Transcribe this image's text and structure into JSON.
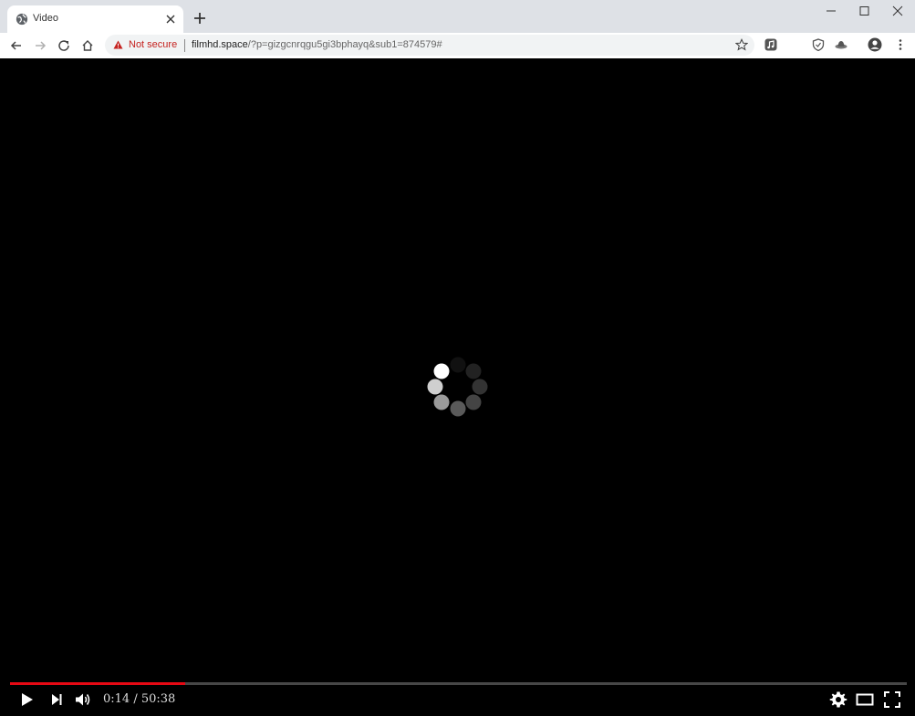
{
  "browser": {
    "tab": {
      "title": "Video",
      "favicon": "globe-icon"
    },
    "address": {
      "security_label": "Not secure",
      "url_domain": "filmhd.space",
      "url_rest": "/?p=gizgcnrqgu5gi3bphayq&sub1=874579#"
    }
  },
  "player": {
    "time_current": "0:14",
    "time_separator": " / ",
    "time_total": "50:38",
    "progress_fraction": 0.195,
    "state": "loading",
    "accent_color": "#e50914"
  }
}
